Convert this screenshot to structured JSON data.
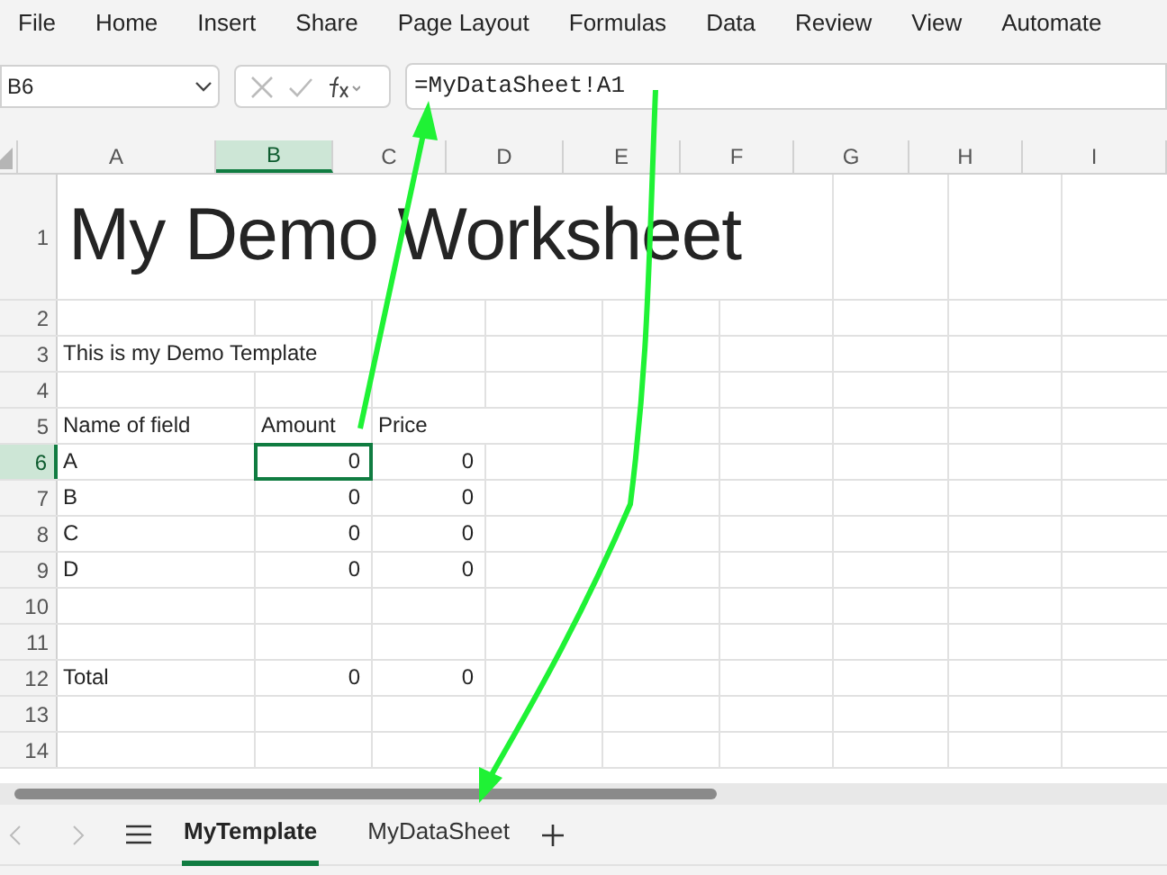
{
  "menu": [
    "File",
    "Home",
    "Insert",
    "Share",
    "Page Layout",
    "Formulas",
    "Data",
    "Review",
    "View",
    "Automate"
  ],
  "formula_bar": {
    "name_box": "B6",
    "formula": "=MyDataSheet!A1"
  },
  "columns": [
    {
      "label": "A",
      "selected": false
    },
    {
      "label": "B",
      "selected": true
    },
    {
      "label": "C",
      "selected": false
    },
    {
      "label": "D",
      "selected": false
    },
    {
      "label": "E",
      "selected": false
    },
    {
      "label": "F",
      "selected": false
    },
    {
      "label": "G",
      "selected": false
    },
    {
      "label": "H",
      "selected": false
    },
    {
      "label": "I",
      "selected": false
    }
  ],
  "rows": [
    {
      "header": "1",
      "selected": false,
      "cells": [
        {
          "text": "My Demo Worksheet",
          "kind": "title"
        }
      ]
    },
    {
      "header": "2",
      "selected": false
    },
    {
      "header": "3",
      "selected": false,
      "cells": [
        {
          "text": "This is my Demo Template",
          "kind": "text"
        }
      ]
    },
    {
      "header": "4",
      "selected": false
    },
    {
      "header": "5",
      "selected": false,
      "cells": [
        {
          "text": "Name of field",
          "kind": "text"
        },
        {
          "text": "Amount",
          "kind": "text"
        },
        {
          "text": "Price",
          "kind": "text"
        }
      ]
    },
    {
      "header": "6",
      "selected": true,
      "cells": [
        {
          "text": "A",
          "kind": "text"
        },
        {
          "text": "0",
          "kind": "number"
        },
        {
          "text": "0",
          "kind": "number"
        }
      ]
    },
    {
      "header": "7",
      "selected": false,
      "cells": [
        {
          "text": "B",
          "kind": "text"
        },
        {
          "text": "0",
          "kind": "number"
        },
        {
          "text": "0",
          "kind": "number"
        }
      ]
    },
    {
      "header": "8",
      "selected": false,
      "cells": [
        {
          "text": "C",
          "kind": "text"
        },
        {
          "text": "0",
          "kind": "number"
        },
        {
          "text": "0",
          "kind": "number"
        }
      ]
    },
    {
      "header": "9",
      "selected": false,
      "cells": [
        {
          "text": "D",
          "kind": "text"
        },
        {
          "text": "0",
          "kind": "number"
        },
        {
          "text": "0",
          "kind": "number"
        }
      ]
    },
    {
      "header": "10",
      "selected": false
    },
    {
      "header": "11",
      "selected": false
    },
    {
      "header": "12",
      "selected": false,
      "cells": [
        {
          "text": "Total",
          "kind": "text"
        },
        {
          "text": "0",
          "kind": "number"
        },
        {
          "text": "0",
          "kind": "number"
        }
      ]
    },
    {
      "header": "13",
      "selected": false
    },
    {
      "header": "14",
      "selected": false
    }
  ],
  "sheet_tabs": [
    {
      "label": "MyTemplate",
      "selected": true
    },
    {
      "label": "MyDataSheet",
      "selected": false
    }
  ]
}
